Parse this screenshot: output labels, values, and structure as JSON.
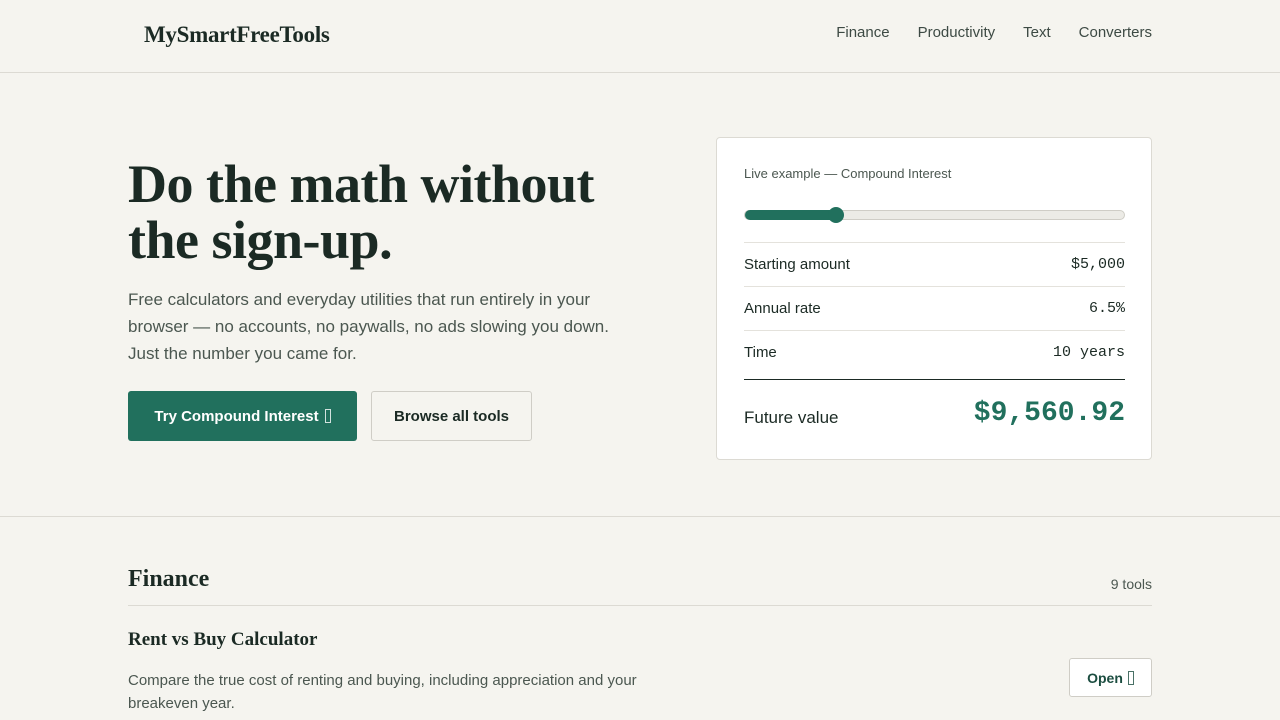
{
  "header": {
    "logo": "MySmartFreeTools",
    "nav": [
      "Finance",
      "Productivity",
      "Text",
      "Converters"
    ]
  },
  "hero": {
    "title": "Do the math without the sign-up.",
    "subtitle": "Free calculators and everyday utilities that run entirely in your browser — no accounts, no paywalls, no ads slowing you down. Just the number you came for.",
    "primary_button": "Try Compound Interest",
    "secondary_button": "Browse all tools"
  },
  "example_card": {
    "label": "Live example — Compound Interest",
    "slider_value_pct": 24,
    "rows": [
      {
        "label": "Starting amount",
        "value": "$5,000"
      },
      {
        "label": "Annual rate",
        "value": "6.5%"
      },
      {
        "label": "Time",
        "value": "10 years"
      }
    ],
    "total_label": "Future value",
    "total_value": "$9,560.92"
  },
  "section": {
    "title": "Finance",
    "count": "9 tools",
    "tool": {
      "title": "Rent vs Buy Calculator",
      "description": "Compare the true cost of renting and buying, including appreciation and your breakeven year.",
      "button": "Open"
    }
  },
  "colors": {
    "accent": "#21705d",
    "background": "#f5f4ef",
    "text": "#1b2a24"
  }
}
